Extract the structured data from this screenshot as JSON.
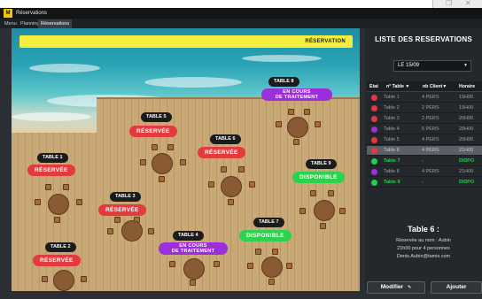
{
  "window": {
    "title": "Réservations"
  },
  "tabs": [
    {
      "label": "Menu",
      "active": false
    },
    {
      "label": "Planning",
      "active": false
    },
    {
      "label": "Réservations",
      "active": true
    }
  ],
  "floor": {
    "banner_label": "RÉSERVATION",
    "tables": [
      {
        "name": "TABLE 1",
        "status": "RÉSERVÉE"
      },
      {
        "name": "TABLE 2",
        "status": "RÉSERVÉE"
      },
      {
        "name": "TABLE 3",
        "status": "RÉSERVÉE"
      },
      {
        "name": "TABLE 4",
        "status": "EN COURS DE TRAITEMENT"
      },
      {
        "name": "TABLE 5",
        "status": "RÉSERVÉE"
      },
      {
        "name": "TABLE 6",
        "status": "RÉSERVÉE"
      },
      {
        "name": "TABLE 7",
        "status": "DISPONIBLE"
      },
      {
        "name": "TABLE 8",
        "status": "EN COURS DE TRAITEMENT"
      },
      {
        "name": "TABLE 9",
        "status": "DISPONIBLE"
      }
    ]
  },
  "panel": {
    "title": "LISTE DES RESERVATIONS",
    "date_selected": "LE 15/09",
    "columns": [
      "Etat",
      "n° Table ▼",
      "nb Client▼",
      "Horaire"
    ],
    "rows": [
      {
        "state_color": "#e8383d",
        "table": "Table 1",
        "clients": "4 PERS",
        "time": "19H00",
        "selected": false,
        "available": false
      },
      {
        "state_color": "#e8383d",
        "table": "Table 2",
        "clients": "2 PERS",
        "time": "19H00",
        "selected": false,
        "available": false
      },
      {
        "state_color": "#e8383d",
        "table": "Table 3",
        "clients": "2 PERS",
        "time": "20H00",
        "selected": false,
        "available": false
      },
      {
        "state_color": "#9b2fd9",
        "table": "Table 4",
        "clients": "5 PERS",
        "time": "20H00",
        "selected": false,
        "available": false
      },
      {
        "state_color": "#e8383d",
        "table": "Table 5",
        "clients": "4 PERS",
        "time": "20H00",
        "selected": false,
        "available": false
      },
      {
        "state_color": "#e8383d",
        "table": "Table 6",
        "clients": "4 PERS",
        "time": "21H00",
        "selected": true,
        "available": false
      },
      {
        "state_color": "#1fd24a",
        "table": "Table 7",
        "clients": "-",
        "time": "DISPO",
        "selected": false,
        "available": true
      },
      {
        "state_color": "#9b2fd9",
        "table": "Table 8",
        "clients": "4 PERS",
        "time": "21H00",
        "selected": false,
        "available": false
      },
      {
        "state_color": "#1fd24a",
        "table": "Table 9",
        "clients": "-",
        "time": "DISPO",
        "selected": false,
        "available": true
      }
    ],
    "details": {
      "title": "Table 6 :",
      "line1": "Réservée au nom : Aubin",
      "line2": "21h00 pour 4 personnes",
      "line3": "Denis.Aubin@tamis.com"
    },
    "modify_label": "Modifier",
    "add_label": "Ajouter"
  },
  "colors": {
    "reserved": "#e33a3e",
    "available": "#2ed14e",
    "in_progress": "#9b2fd9",
    "banner": "#f6ee3e"
  },
  "icons": {
    "app": "app-logo-icon",
    "edit": "pencil-icon",
    "dropdown": "chevron-down-icon"
  }
}
